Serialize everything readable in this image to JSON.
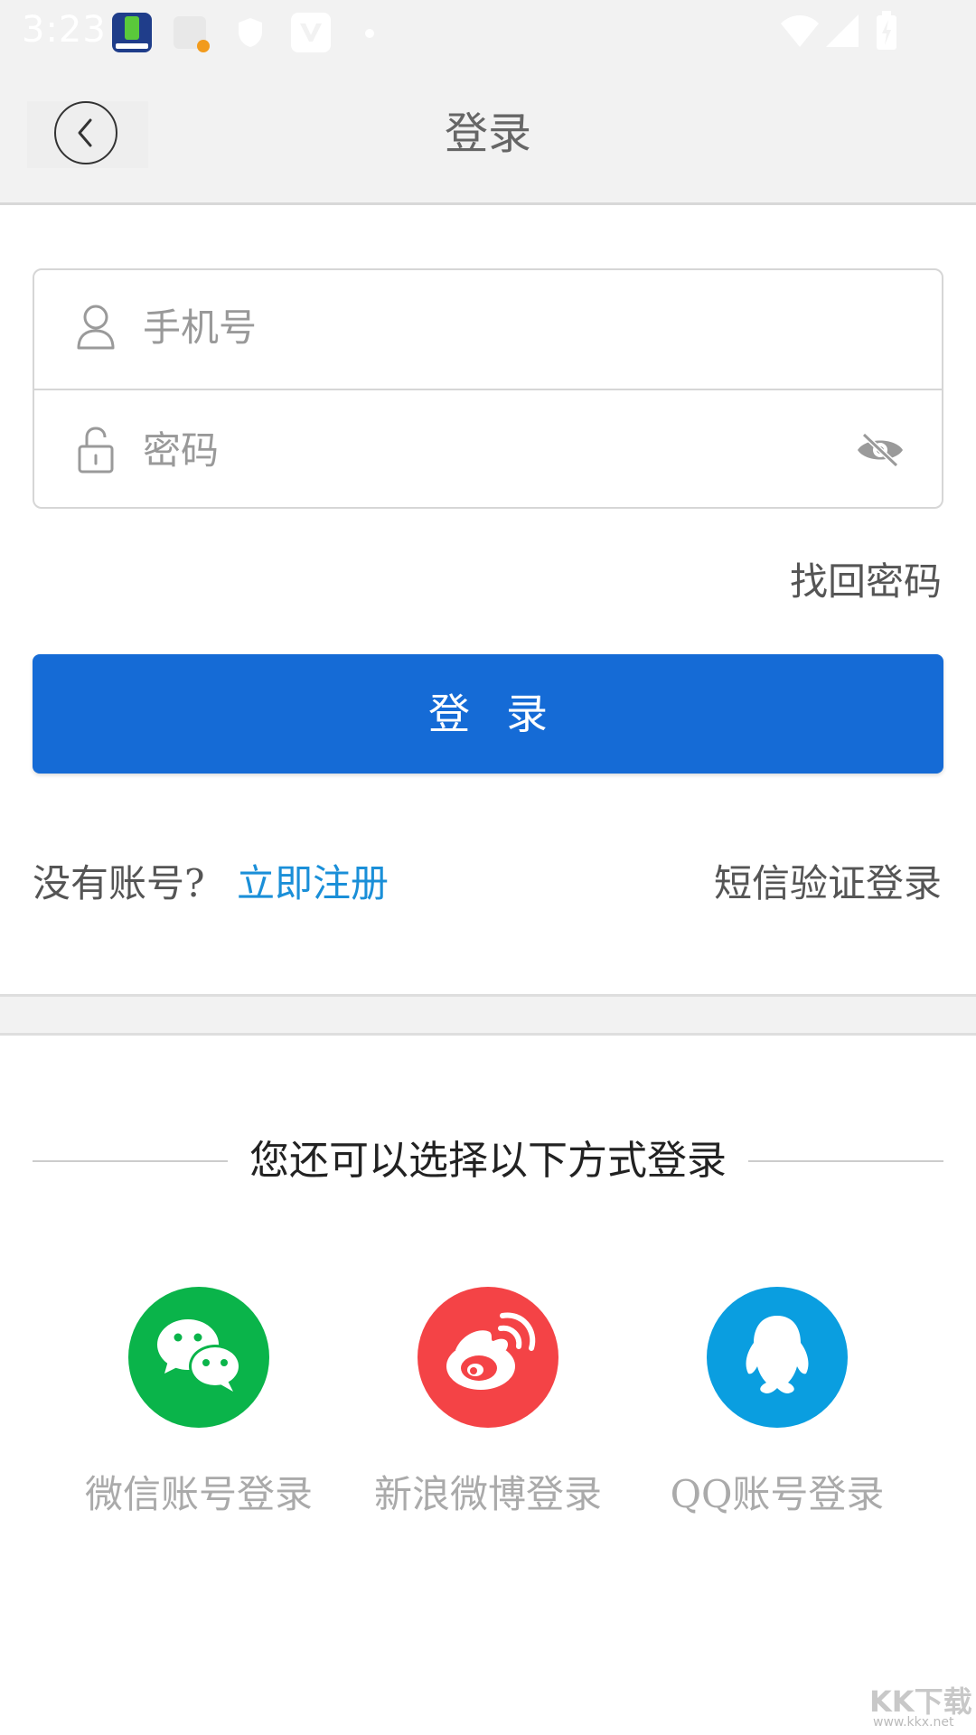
{
  "status_bar": {
    "time": "3:23"
  },
  "header": {
    "title": "登录",
    "back_icon": "chevron-left-icon"
  },
  "form": {
    "phone_placeholder": "手机号",
    "password_placeholder": "密码",
    "user_icon": "user-icon",
    "lock_icon": "lock-icon",
    "visibility_icon": "eye-off-icon"
  },
  "forgot_password": "找回密码",
  "login_button": "登录",
  "register_row": {
    "prompt": "没有账号?",
    "register_link": "立即注册",
    "sms_login": "短信验证登录"
  },
  "other_login": {
    "title": "您还可以选择以下方式登录",
    "options": [
      {
        "label": "微信账号登录",
        "icon": "wechat-icon",
        "color": "#0ab44a"
      },
      {
        "label": "新浪微博登录",
        "icon": "weibo-icon",
        "color": "#f44346"
      },
      {
        "label": "QQ账号登录",
        "icon": "qq-icon",
        "color": "#0a9ee0"
      }
    ]
  },
  "colors": {
    "primary": "#156bd6",
    "link": "#1a8fd8"
  },
  "watermark": {
    "brand": "KK下载",
    "url": "www.kkx.net"
  }
}
